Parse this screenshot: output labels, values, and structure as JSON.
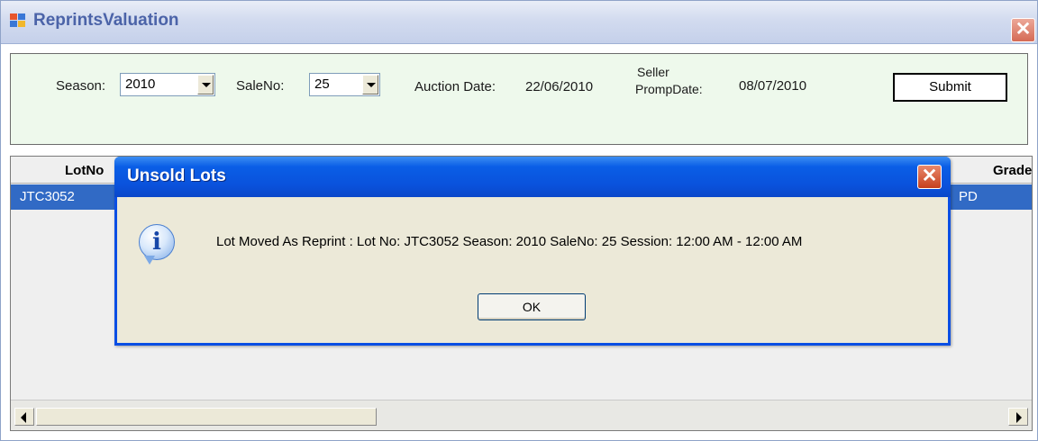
{
  "window": {
    "title": "ReprintsValuation",
    "close_glyph": "✕"
  },
  "filter": {
    "season_label": "Season:",
    "season_value": "2010",
    "saleno_label": "SaleNo:",
    "saleno_value": "25",
    "auction_date_label": "Auction Date:",
    "auction_date_value": "22/06/2010",
    "seller_prompt_label_line1": "Seller",
    "seller_prompt_label_line2": "PrompDate:",
    "seller_prompt_value": "08/07/2010",
    "submit_label": "Submit"
  },
  "grid": {
    "columns": [
      "LotNo",
      "Grade"
    ],
    "rows": [
      {
        "lotno": "JTC3052",
        "grade": "PD"
      }
    ]
  },
  "dialog": {
    "title": "Unsold Lots",
    "close_glyph": "✕",
    "icon": "info-icon",
    "icon_glyph": "i",
    "message": "Lot Moved As Reprint : Lot No: JTC3052 Season: 2010  SaleNo: 25 Session: 12:00 AM - 12:00 AM",
    "ok_label": "OK"
  },
  "colors": {
    "dialog_title": "#0a52dc",
    "selected_row": "#316ac5",
    "filter_panel": "#eef9ec"
  }
}
